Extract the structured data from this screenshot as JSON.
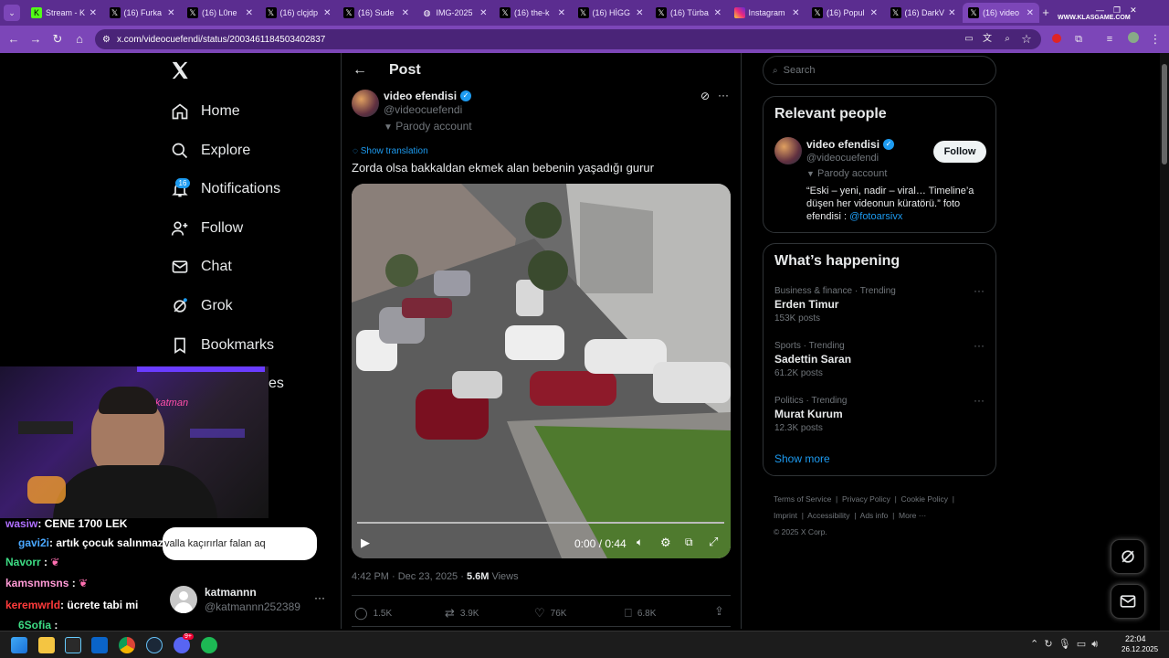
{
  "browser": {
    "tabs": [
      {
        "title": "Stream - K",
        "icon": "kick-icon",
        "color": "#53fc18"
      },
      {
        "title": "(16) Furka",
        "icon": "x-icon"
      },
      {
        "title": "(16) L0ne",
        "icon": "x-icon"
      },
      {
        "title": "(16) clçjdp",
        "icon": "x-icon"
      },
      {
        "title": "(16) Sude",
        "icon": "x-icon"
      },
      {
        "title": "IMG-2025",
        "icon": "globe-icon"
      },
      {
        "title": "(16) the-k",
        "icon": "x-icon"
      },
      {
        "title": "(16) HİGG",
        "icon": "x-icon"
      },
      {
        "title": "(16) Türba",
        "icon": "x-icon"
      },
      {
        "title": "Instagram",
        "icon": "instagram-icon"
      },
      {
        "title": "(16) Popul",
        "icon": "x-icon"
      },
      {
        "title": "(16) DarkV",
        "icon": "x-icon"
      },
      {
        "title": "(16) video",
        "icon": "x-icon",
        "active": true
      }
    ],
    "url": "x.com/videocuefendi/status/2003461184503402837",
    "watermark": "WWW.KLASGAME.COM"
  },
  "nav": {
    "home": "Home",
    "explore": "Explore",
    "notifications": "Notifications",
    "notifications_badge": "16",
    "follow": "Follow",
    "chat": "Chat",
    "grok": "Grok",
    "bookmarks": "Bookmarks",
    "more_partial": "es"
  },
  "account": {
    "name": "katmannn",
    "handle": "@katmannn252389"
  },
  "post": {
    "header": "Post",
    "author_name": "video efendisi",
    "author_handle": "@videocuefendi",
    "parody_label": "Parody account",
    "show_translation": "Show translation",
    "text": "Zorda olsa bakkaldan ekmek alan bebenin yaşadığı gurur",
    "video_time": "0:00 / 0:44",
    "timestamp": "4:42 PM · Dec 23, 2025 · ",
    "views_count": "5.6M",
    "views_label": " Views",
    "replies": "1.5K",
    "reposts": "3.9K",
    "likes": "76K",
    "bookmarks": "6.8K"
  },
  "search": {
    "placeholder": "Search"
  },
  "relevant": {
    "title": "Relevant people",
    "name": "video efendisi",
    "handle": "@videocuefendi",
    "parody_label": "Parody account",
    "bio": "“Eski – yeni, nadir – viral… Timeline’a düşen her videonun küratörü.” foto efendisi : ",
    "bio_link": "@fotoarsivx",
    "follow_button": "Follow"
  },
  "happening": {
    "title": "What’s happening",
    "trends": [
      {
        "category": "Business & finance · Trending",
        "name": "Erden Timur",
        "posts": "153K posts"
      },
      {
        "category": "Sports · Trending",
        "name": "Sadettin Saran",
        "posts": "61.2K posts"
      },
      {
        "category": "Politics · Trending",
        "name": "Murat Kurum",
        "posts": "12.3K posts"
      }
    ],
    "show_more": "Show more"
  },
  "footer": {
    "terms": "Terms of Service",
    "privacy": "Privacy Policy",
    "cookie": "Cookie Policy",
    "imprint": "Imprint",
    "accessibility": "Accessibility",
    "ads": "Ads info",
    "more": "More ···",
    "copyright": "© 2025 X Corp."
  },
  "chat_overlay": {
    "lines": [
      {
        "user": "wasiw",
        "msg": ": CENE 1700 LEK",
        "color": "#b070ff"
      },
      {
        "user": "gavi2i",
        "msg": ": artık çocuk salınmaz",
        "color": "#4aa8ff"
      },
      {
        "user": "Navorr",
        "msg": ":",
        "color": "#3ddc84"
      },
      {
        "user": "kamsnmsns",
        "msg": ":",
        "color": "#ff9ad5"
      },
      {
        "user": "keremwrld",
        "msg": ": ücrete tabi mi",
        "color": "#ff3b3b"
      },
      {
        "user": "6Sofia",
        "msg": ":",
        "color": "#3ddc84"
      }
    ],
    "bubble": "valla kaçırırlar falan aq"
  },
  "taskbar": {
    "time": "22:04",
    "date": "26.12.2025",
    "discord_badge": "9+"
  },
  "colors": {
    "accent": "#1d9bf0",
    "browser_purple": "#7c46b8"
  }
}
